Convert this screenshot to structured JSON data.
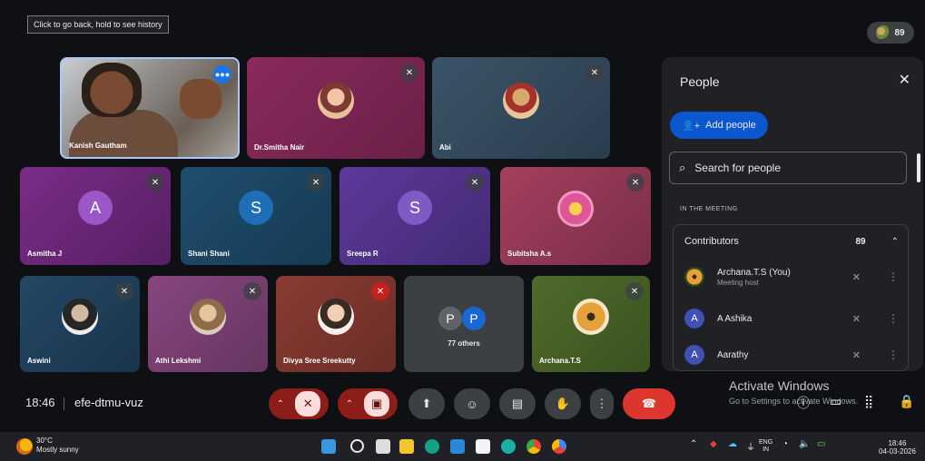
{
  "top": {
    "back_tooltip": "Click to go back, hold to see history",
    "participant_count": "89"
  },
  "tiles": {
    "kanish": "Kanish Gautham",
    "smitha": "Dr.Smitha Nair",
    "abi": "Abi",
    "asmitha": "Asmitha J",
    "asmitha_initial": "A",
    "shani": "Shani Shani",
    "shani_initial": "S",
    "sreepa": "Sreepa R",
    "sreepa_initial": "S",
    "subitsha": "Subitsha A.s",
    "aswini": "Aswini",
    "athi": "Athi Lekshmi",
    "divya": "Divya Sree Sreekutty",
    "others_a": "P",
    "others_b": "P",
    "others_label": "77 others",
    "archana": "Archana.T.S"
  },
  "panel": {
    "title": "People",
    "add_people": "Add people",
    "search_placeholder": "Search for people",
    "section_label": "IN THE MEETING",
    "group_label": "Contributors",
    "group_count": "89",
    "people": [
      {
        "name": "Archana.T.S (You)",
        "sub": "Meeting host"
      },
      {
        "name": "A Ashika",
        "initial": "A"
      },
      {
        "name": "Aarathy",
        "initial": "A"
      }
    ]
  },
  "bottom": {
    "time": "18:46",
    "meeting_code": "efe-dtmu-vuz"
  },
  "watermark": {
    "line1": "Activate Windows",
    "line2": "Go to Settings to activate Windows."
  },
  "taskbar": {
    "temp": "30°C",
    "weather": "Mostly sunny",
    "lang1": "ENG",
    "lang2": "IN",
    "clock_time": "18:46",
    "clock_date": "04-03-2026"
  },
  "colors": {
    "accent": "#0b57d0",
    "end_call": "#dc362e",
    "mute_red": "#c5221f"
  }
}
